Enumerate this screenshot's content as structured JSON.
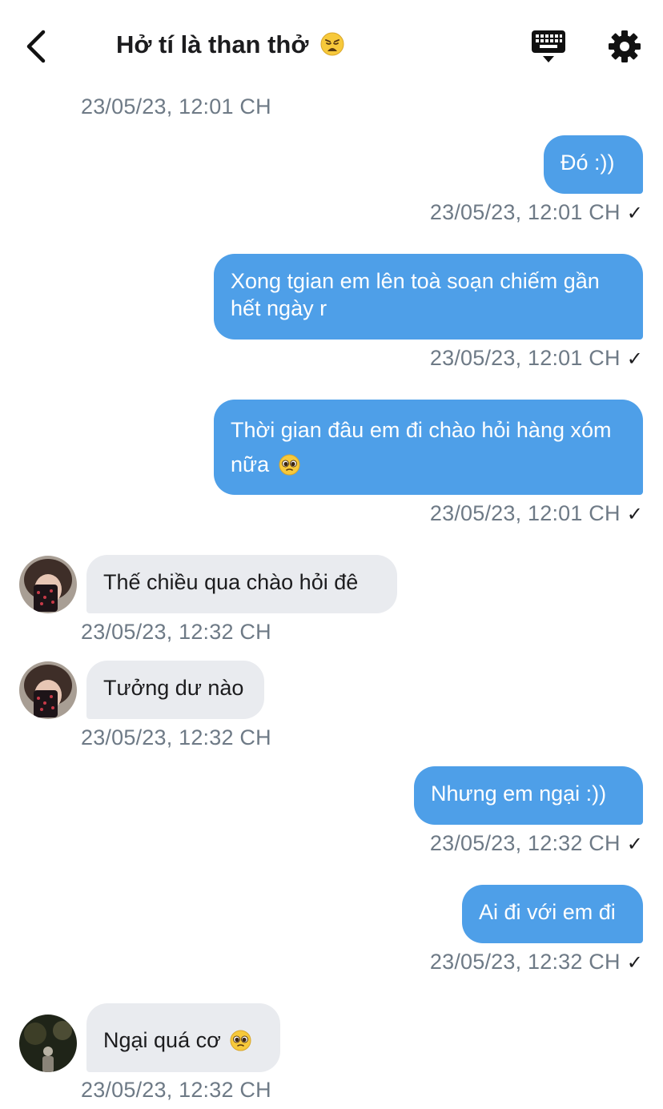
{
  "header": {
    "title": "Hở tí là than thở",
    "title_emoji": "weary-face-emoji",
    "back_icon": "chevron-left-icon",
    "keyboard_icon": "keyboard-icon",
    "settings_icon": "gear-icon"
  },
  "colors": {
    "outgoing_bubble": "#4e9fe8",
    "incoming_bubble": "#e9ebef",
    "timestamp": "#6e7a86"
  },
  "messages": [
    {
      "ts": "23/05/23, 12:01 CH"
    },
    {
      "text": "Đó :))",
      "ts": "23/05/23, 12:01 CH",
      "check": "✓"
    },
    {
      "text": "Xong tgian em lên toà soạn chiếm gần hết ngày r",
      "ts": "23/05/23, 12:01 CH",
      "check": "✓"
    },
    {
      "text": "Thời gian đâu em đi chào hỏi hàng xóm nữa",
      "emoji": "pleading-face-emoji",
      "ts": "23/05/23, 12:01 CH",
      "check": "✓"
    },
    {
      "text": "Thế chiều qua chào hỏi đê",
      "ts": "23/05/23, 12:32 CH"
    },
    {
      "text": "Tưởng dư nào",
      "ts": "23/05/23, 12:32 CH"
    },
    {
      "text": "Nhưng em ngại :))",
      "ts": "23/05/23, 12:32 CH",
      "check": "✓"
    },
    {
      "text": "Ai đi với em đi",
      "ts": "23/05/23, 12:32 CH",
      "check": "✓"
    },
    {
      "text": "Ngại quá cơ",
      "emoji": "pleading-face-emoji",
      "ts": "23/05/23, 12:32 CH"
    }
  ]
}
